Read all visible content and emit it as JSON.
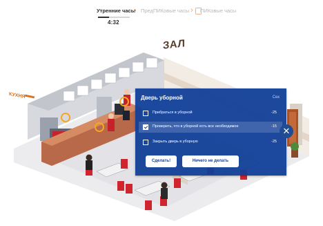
{
  "header": {
    "phases": [
      "Утренние часы",
      "ПредПИКовые часы",
      "ПИКовые часы"
    ],
    "active_phase_progress": 0.35,
    "timer": "4:32"
  },
  "scene": {
    "hall_label": "ЗАЛ",
    "kitchen_label": "КУХНЯ"
  },
  "dialog": {
    "title": "Дверь уборной",
    "unit": "Сек",
    "options": [
      {
        "label": "Прибраться в уборной",
        "score": "-25",
        "checked": false
      },
      {
        "label": "Проверить, что в уборной есть все необходимое",
        "score": "-15",
        "checked": true
      },
      {
        "label": "Закрыть дверь в уборную",
        "score": "-25",
        "checked": false
      }
    ],
    "confirm_label": "Сделать!",
    "cancel_label": "Ничего не делать"
  },
  "icons": {
    "close": "close-icon",
    "chevron": "chevron-right-icon",
    "clock": "clock-icon"
  },
  "colors": {
    "dialog_bg": "#113f98",
    "accent": "#f0a36b",
    "floor": "#e9e9ec"
  }
}
